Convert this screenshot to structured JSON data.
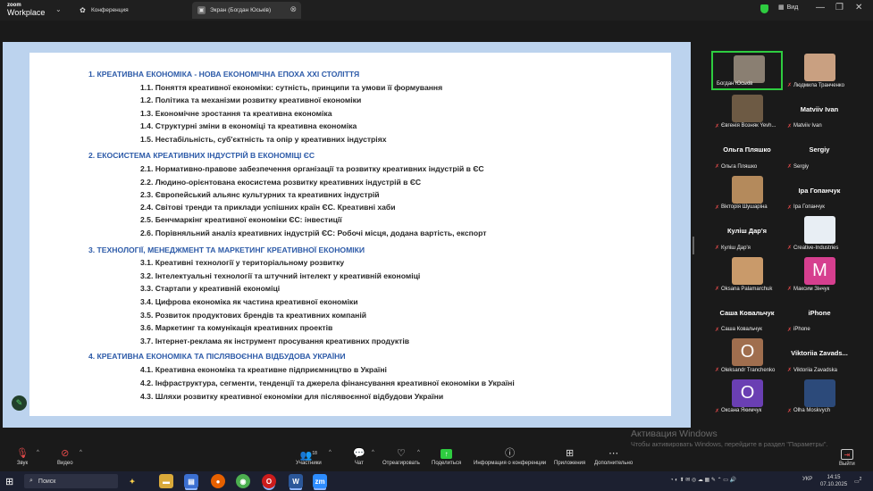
{
  "titlebar": {
    "brand_top": "zoom",
    "brand_bottom": "Workplace",
    "tab_meeting": "Конференция",
    "tab_screen": "Экран (Богдан Юськів)",
    "view_label": "Вид"
  },
  "slide": {
    "sections": [
      {
        "title": "1. КРЕАТИВНА ЕКОНОМІКА - НОВА ЕКОНОМІЧНА ЕПОХА XXI СТОЛІТТЯ",
        "items": [
          "1.1. Поняття креативної економіки: сутність, принципи та умови її формування",
          "1.2. Політика та механізми розвитку креативної економіки",
          "1.3. Економічне зростання та креативна економіка",
          "1.4. Структурні зміни в економіці та креативна економіка",
          "1.5. Нестабільність, суб'єктність та опір у креативних індустріях"
        ]
      },
      {
        "title": "2. ЕКОСИСТЕМА КРЕАТИВНИХ ІНДУСТРІЙ В ЕКОНОМІЦІ ЄС",
        "items": [
          "2.1. Нормативно-правове забезпечення організації та розвитку креативних індустрій в ЄС",
          "2.2. Людино-орієнтована екосистема розвитку креативних індустрій в ЄС",
          "2.3. Європейський альянс культурних та креативних індустрій",
          "2.4. Світові тренди та приклади успішних країн ЄС. Креативні хаби",
          "2.5. Бенчмаркінг креативної економіки ЄС: інвестиції",
          "2.6. Порівняльний аналіз креативних індустрій ЄС: Робочі місця, додана вартість, експорт"
        ]
      },
      {
        "title": "3. ТЕХНОЛОГІЇ, МЕНЕДЖМЕНТ ТА МАРКЕТИНГ КРЕАТИВНОЇ ЕКОНОМІКИ",
        "items": [
          "3.1. Креативні технології у територіальному розвитку",
          "3.2. Інтелектуальні технології та штучний інтелект у креативній економіці",
          "3.3. Стартапи у креативній економіці",
          "3.4. Цифрова економіка як частина креативної економіки",
          "3.5. Розвиток продуктових брендів та креативних компаній",
          "3.6. Маркетинг та комунікація креативних проектів",
          "3.7. Інтернет-реклама як інструмент просування креативних продуктів"
        ]
      },
      {
        "title": "4. КРЕАТИВНА ЕКОНОМІКА ТА ПІСЛЯВОЄННА ВІДБУДОВА УКРАЇНИ",
        "items": [
          "4.1. Креативна економіка та креативне підприємництво в Україні",
          "4.2. Інфраструктура, сегменти, тенденції та джерела фінансування креативної економіки в Україні",
          "4.3. Шляхи розвитку креативної економіки для післявоєнної відбудови України"
        ]
      }
    ]
  },
  "participants": [
    {
      "name": "Богдан Юськів",
      "big": "",
      "avatar": "photo",
      "color": "#8a7f72",
      "muted": false,
      "active": true
    },
    {
      "name": "Людмила Транченко",
      "big": "",
      "avatar": "photo",
      "color": "#c9a081",
      "muted": true,
      "active": false
    },
    {
      "name": "Євгенія Возняк Yevh...",
      "big": "",
      "avatar": "photo",
      "color": "#6d5a44",
      "muted": true,
      "active": false
    },
    {
      "name": "Matviiv Ivan",
      "big": "Matviiv Ivan",
      "avatar": "",
      "color": "",
      "muted": true,
      "active": false
    },
    {
      "name": "Ольга Пляшко",
      "big": "Ольга Пляшко",
      "avatar": "",
      "color": "",
      "muted": true,
      "active": false
    },
    {
      "name": "Sergiy",
      "big": "Sergiy",
      "avatar": "",
      "color": "",
      "muted": true,
      "active": false
    },
    {
      "name": "Вікторія Шушаріна",
      "big": "",
      "avatar": "photo",
      "color": "#b48a5c",
      "muted": true,
      "active": false
    },
    {
      "name": "Іра Гопанчук",
      "big": "Іра Гопанчук",
      "avatar": "",
      "color": "",
      "muted": true,
      "active": false
    },
    {
      "name": "Куліш Дар'я",
      "big": "Куліш Дар'я",
      "avatar": "",
      "color": "",
      "muted": true,
      "active": false
    },
    {
      "name": "Creative-Industries",
      "big": "",
      "avatar": "photo",
      "color": "#e8eef4",
      "muted": true,
      "active": false
    },
    {
      "name": "Oksana Palamarchuk",
      "big": "",
      "avatar": "photo",
      "color": "#c99a6a",
      "muted": true,
      "active": false
    },
    {
      "name": "Максим Зінчук",
      "big": "",
      "avatar": "M",
      "color": "#d63f8f",
      "muted": true,
      "active": false
    },
    {
      "name": "Саша Ковальчук",
      "big": "Саша Ковальчук",
      "avatar": "",
      "color": "",
      "muted": true,
      "active": false
    },
    {
      "name": "iPhone",
      "big": "iPhone",
      "avatar": "",
      "color": "",
      "muted": true,
      "active": false
    },
    {
      "name": "Oleksandr Tranchenko",
      "big": "",
      "avatar": "O",
      "color": "#a06e4e",
      "muted": true,
      "active": false
    },
    {
      "name": "Viktoriia Zavadska",
      "big": "Viktoriia  Zavads...",
      "avatar": "",
      "color": "",
      "muted": true,
      "active": false
    },
    {
      "name": "Оксана Якимчук",
      "big": "",
      "avatar": "O",
      "color": "#6a3fb3",
      "muted": true,
      "active": false
    },
    {
      "name": "Olha Moskvych",
      "big": "",
      "avatar": "photo",
      "color": "#2c4a7a",
      "muted": true,
      "active": false
    }
  ],
  "activation": {
    "title": "Активация Windows",
    "text": "Чтобы активировать Windows, перейдите в раздел \"Параметры\"."
  },
  "controls": {
    "audio": "Звук",
    "video": "Видео",
    "participants": "Участники",
    "participants_count": "18",
    "chat": "Чат",
    "react": "Отреагировать",
    "share": "Поделиться",
    "info": "Информация о конференции",
    "apps": "Приложения",
    "more": "Дополнительно",
    "leave": "Выйти"
  },
  "taskbar": {
    "search": "Поиск",
    "lang": "УКР",
    "time": "14:15",
    "date": "07.10.2025",
    "notif": "2"
  }
}
